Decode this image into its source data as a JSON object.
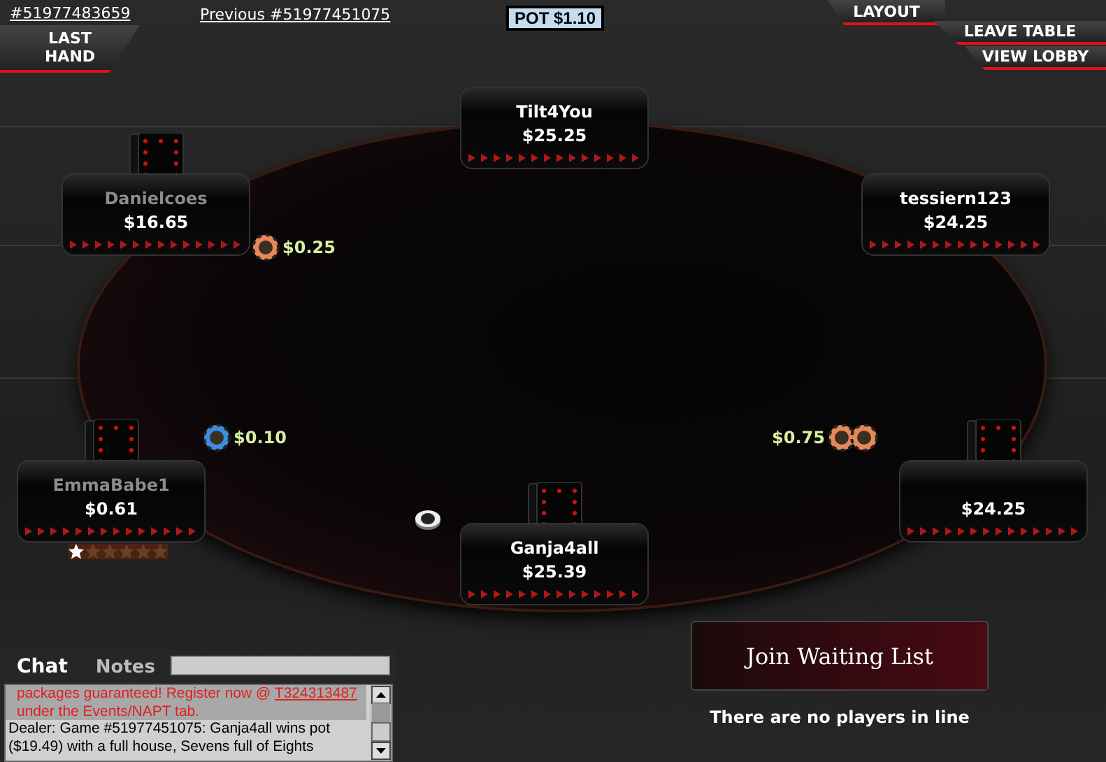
{
  "top_bar": {
    "hand_link": "#51977483659",
    "last_hand_button": "LAST\nHAND",
    "previous_link": "Previous #51977451075",
    "pot": "POT $1.10",
    "menu": [
      "LAYOUT",
      "LEAVE TABLE",
      "VIEW LOBBY"
    ]
  },
  "seats": [
    {
      "name": "Tilt4You",
      "stack": "$25.25",
      "dimmed": false
    },
    {
      "name": "tessiern123",
      "stack": "$24.25",
      "dimmed": false
    },
    {
      "stack": "$24.25",
      "has_cards": true,
      "bet": {
        "amount": "$0.75",
        "chips": [
          {
            "color": "#e8875a"
          },
          {
            "color": "#e8875a"
          }
        ]
      }
    },
    {
      "name": "Ganja4all",
      "stack": "$25.39",
      "dimmed": false,
      "has_cards": true,
      "dealer": true
    },
    {
      "name": "EmmaBabe1",
      "stack": "$0.61",
      "dimmed": true,
      "has_cards": true,
      "stars": 1,
      "bet": {
        "amount": "$0.10",
        "chips": [
          {
            "color": "#3a8ee0"
          }
        ]
      }
    },
    {
      "name": "Danielcoes",
      "stack": "$16.65",
      "dimmed": true,
      "has_cards": true,
      "bet": {
        "amount": "$0.25",
        "chips": [
          {
            "color": "#e8875a"
          }
        ]
      }
    }
  ],
  "chat": {
    "tabs": [
      {
        "label": "Chat",
        "selected": true
      },
      {
        "label": "Notes",
        "selected": false
      }
    ],
    "messages": [
      {
        "kind": "promo",
        "text": "packages guaranteed!  Register now @ ",
        "link": "T324313487"
      },
      {
        "kind": "promo",
        "text": "under the Events/NAPT tab."
      },
      {
        "kind": "dealer",
        "text": "Dealer: Game #51977451075: Ganja4all wins pot"
      },
      {
        "kind": "dealer",
        "text": " ($19.49) with a full house, Sevens full of Eights"
      }
    ]
  },
  "waiting_list": {
    "button": "Join Waiting List",
    "status": "There are no players in line"
  }
}
